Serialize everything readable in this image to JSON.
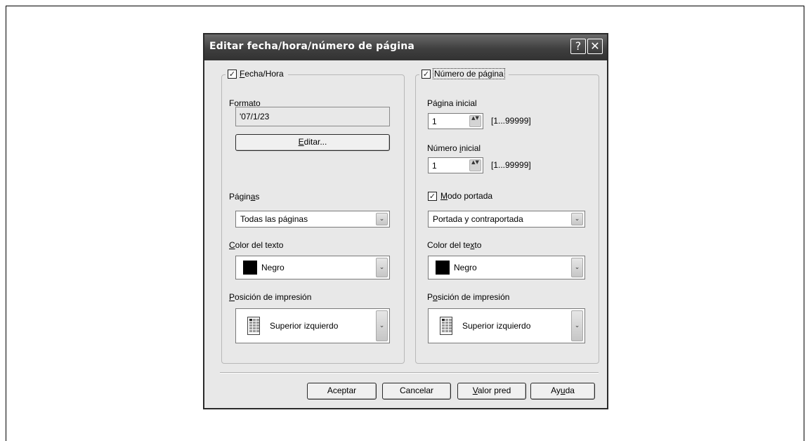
{
  "dialog": {
    "title": "Editar fecha/hora/número de página"
  },
  "date_group": {
    "checkbox_label_pre": "",
    "checkbox_label_ul": "F",
    "checkbox_label_post": "echa/Hora",
    "checked": true,
    "format_label": "Formato",
    "format_value": "'07/1/23",
    "edit_button_ul": "E",
    "edit_button_post": "ditar...",
    "pages_label_pre": "Págin",
    "pages_label_ul": "a",
    "pages_label_post": "s",
    "pages_value": "Todas las páginas",
    "text_color_label_ul": "C",
    "text_color_label_post": "olor del texto",
    "text_color_value": "Negro",
    "print_position_label_ul": "P",
    "print_position_label_post": "osición de impresión",
    "print_position_value": "Superior izquierdo"
  },
  "page_group": {
    "checkbox_label": "Número de página",
    "checked": true,
    "start_page_label": "Página inicial",
    "start_page_value": "1",
    "start_page_range": "[1...99999]",
    "start_number_label_pre": "Número ",
    "start_number_label_ul": "i",
    "start_number_label_post": "nicial",
    "start_number_value": "1",
    "start_number_range": "[1...99999]",
    "cover_mode_label_ul": "M",
    "cover_mode_label_post": "odo portada",
    "cover_mode_checked": true,
    "cover_mode_value": "Portada y contraportada",
    "text_color_label_pre": "Color del te",
    "text_color_label_ul": "x",
    "text_color_label_post": "to",
    "text_color_value": "Negro",
    "print_position_label_pre": "P",
    "print_position_label_ul": "o",
    "print_position_label_post": "sición de impresión",
    "print_position_value": "Superior izquierdo"
  },
  "footer": {
    "ok_label": "Aceptar",
    "cancel_label": "Cancelar",
    "default_label_ul": "V",
    "default_label_post": "alor pred",
    "help_label_pre": "Ay",
    "help_label_ul": "u",
    "help_label_post": "da"
  },
  "titlebar_buttons": {
    "help_glyph": "?",
    "close_glyph": "✕"
  },
  "glyphs": {
    "check": "✓",
    "spin": "▲▼",
    "dropdown": "⌄"
  },
  "colors": {
    "titlebar": "#3f3f3f",
    "dialog_bg": "#e8e8e8",
    "swatch": "#000000"
  }
}
